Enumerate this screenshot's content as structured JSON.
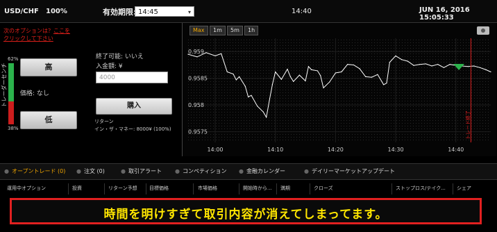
{
  "topbar": {
    "pair": "USD/CHF",
    "percent": "100%",
    "expiry_label": "有効期限:",
    "expiry_value": "14:45",
    "clock": "14:40",
    "datetime": "JUN 16, 2016 15:05:33"
  },
  "left": {
    "notice_prefix": "次のオプションは？",
    "notice_link": "ここをクリックして下さい",
    "high_label": "高",
    "low_label": "低",
    "price_label": "価格: なし",
    "gauge_top": "62%",
    "gauge_bottom": "38%",
    "gauge_up_fraction": 0.62,
    "trader_label": "トレーダーセンチ"
  },
  "middle": {
    "end_possible": "終了可能: いいえ",
    "amount_label": "入金額: ¥",
    "amount_placeholder": "4000",
    "buy_label": "購入",
    "return_label": "リターン",
    "return_value": "イン・ザ・マネー: 8000¥ (100%)"
  },
  "chart": {
    "timeframes": [
      "Max",
      "1m",
      "5m",
      "1h"
    ],
    "active_timeframe": "Max",
    "camera_icon": "camera-icon",
    "expiry_marker_label": "トレード終了",
    "colors": {
      "line": "#ffffff",
      "marker": "#e02020",
      "entry": "#2bb24c"
    }
  },
  "chart_data": {
    "type": "line",
    "title": "",
    "xlabel": "",
    "ylabel": "",
    "x_ticks": [
      "14:00",
      "14:10",
      "14:20",
      "14:30",
      "14:40"
    ],
    "y_ticks": [
      "0.959",
      "0.9585",
      "0.958",
      "0.9575"
    ],
    "ylim": [
      0.9573,
      0.95925
    ],
    "x_range_min": [
      -4.5,
      45.8
    ],
    "expiry_marker_min": 42.5,
    "series": [
      {
        "x_min": [
          -4.5,
          -3,
          -1.5,
          0,
          1,
          2,
          3,
          3.5,
          4,
          5,
          5.5,
          6,
          7,
          8,
          8.5,
          9,
          9.5,
          10,
          11,
          12,
          12.5,
          13,
          14,
          15,
          15.5,
          16,
          17,
          17.5,
          18,
          19,
          20,
          21,
          22,
          23,
          24,
          25,
          26,
          27,
          28,
          28.5,
          29,
          30,
          31,
          32,
          33,
          34,
          35,
          36,
          37,
          38,
          39,
          40,
          41,
          42,
          43,
          44,
          45,
          45.8
        ],
        "y": [
          0.95895,
          0.9589,
          0.95898,
          0.95892,
          0.95896,
          0.95862,
          0.95858,
          0.95847,
          0.95853,
          0.95835,
          0.95815,
          0.95818,
          0.95798,
          0.95787,
          0.95777,
          0.95808,
          0.95838,
          0.95862,
          0.95848,
          0.95867,
          0.95853,
          0.95844,
          0.95856,
          0.95845,
          0.95872,
          0.95866,
          0.95864,
          0.95855,
          0.95832,
          0.95843,
          0.9586,
          0.95862,
          0.95876,
          0.95875,
          0.95868,
          0.95853,
          0.95852,
          0.95857,
          0.95838,
          0.95841,
          0.9588,
          0.95892,
          0.95885,
          0.95882,
          0.95874,
          0.95876,
          0.95877,
          0.95873,
          0.95876,
          0.9587,
          0.95876,
          0.95874,
          0.95873,
          0.95872,
          0.95873,
          0.9587,
          0.95866,
          0.95862
        ]
      }
    ]
  },
  "tabs": [
    {
      "label": "オープントレード (0)",
      "active": true
    },
    {
      "label": "注文 (0)",
      "active": false
    },
    {
      "label": "取引アラート",
      "active": false
    },
    {
      "label": "コンペティション",
      "active": false
    },
    {
      "label": "金融カレンダー",
      "active": false
    },
    {
      "label": "デイリーマーケットアップデート",
      "active": false
    }
  ],
  "columns": [
    "運用中オプション",
    "投資",
    "リターン予想",
    "目標価格",
    "市場価格",
    "開始時から...",
    "満期",
    "クローズ",
    "ストップロス/テイク...",
    "シェア"
  ],
  "banner": "時間を明けすぎて取引内容が消えてしまってます。"
}
